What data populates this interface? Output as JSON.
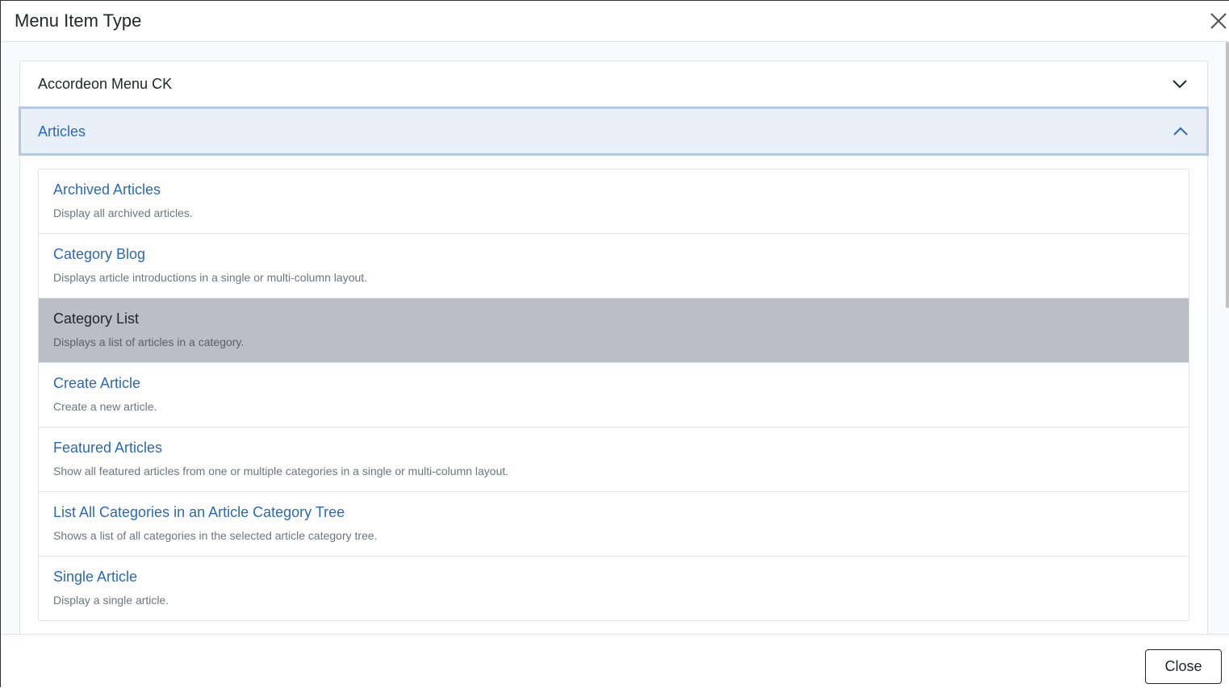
{
  "modal": {
    "title": "Menu Item Type",
    "close_icon": "close-icon"
  },
  "accordion": {
    "sections": [
      {
        "label": "Accordeon Menu CK",
        "expanded": false,
        "icon": "chevron-down-icon"
      },
      {
        "label": "Articles",
        "expanded": true,
        "icon": "chevron-up-icon"
      }
    ]
  },
  "articles": {
    "items": [
      {
        "title": "Archived Articles",
        "description": "Display all archived articles."
      },
      {
        "title": "Category Blog",
        "description": "Displays article introductions in a single or multi-column layout."
      },
      {
        "title": "Category List",
        "description": "Displays a list of articles in a category.",
        "selected": true
      },
      {
        "title": "Create Article",
        "description": "Create a new article."
      },
      {
        "title": "Featured Articles",
        "description": "Show all featured articles from one or multiple categories in a single or multi-column layout."
      },
      {
        "title": "List All Categories in an Article Category Tree",
        "description": "Shows a list of all categories in the selected article category tree."
      },
      {
        "title": "Single Article",
        "description": "Display a single article."
      }
    ]
  },
  "footer": {
    "close_label": "Close"
  },
  "colors": {
    "link": "#2a69b8",
    "active_header_bg": "#e8eff7",
    "selected_item_bg": "#babec6"
  }
}
